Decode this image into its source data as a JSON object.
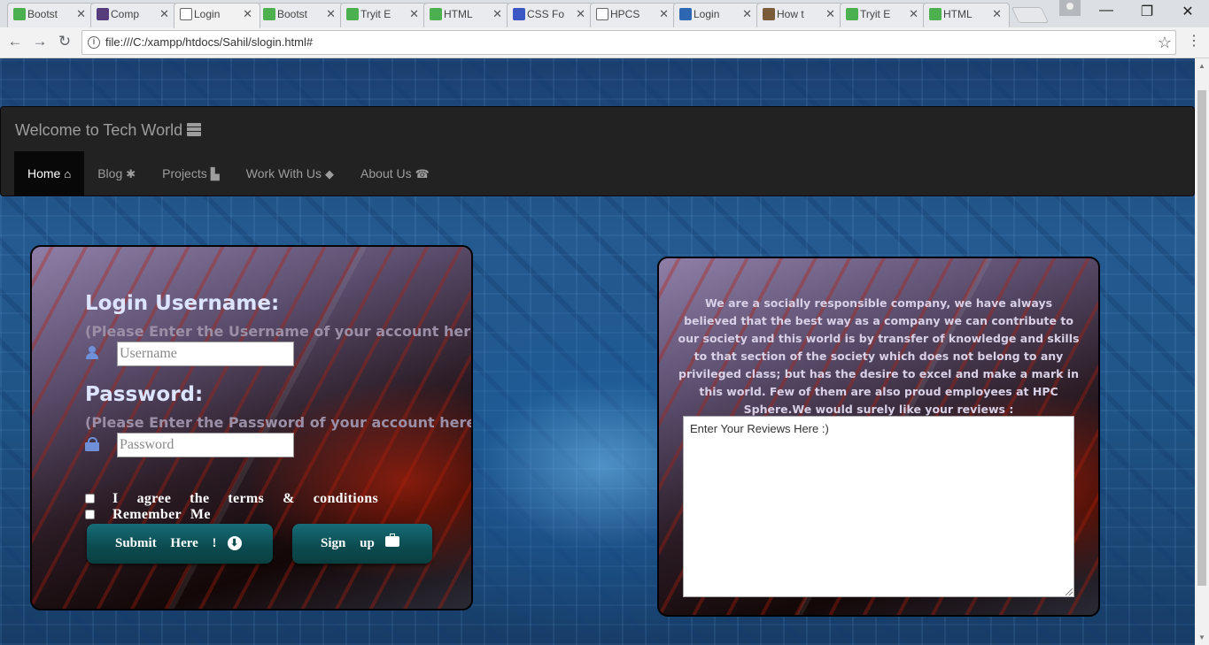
{
  "browser": {
    "tabs": [
      {
        "label": "Bootst",
        "icon": "w3schools-icon",
        "color": "#4caf50"
      },
      {
        "label": "Comp",
        "icon": "bootstrap-icon",
        "color": "#563d7c"
      },
      {
        "label": "Login",
        "icon": "page-icon",
        "color": "#ffffff",
        "active": true
      },
      {
        "label": "Bootst",
        "icon": "w3schools-icon",
        "color": "#4caf50"
      },
      {
        "label": "Tryit E",
        "icon": "w3schools-icon",
        "color": "#4caf50"
      },
      {
        "label": "HTML",
        "icon": "w3schools-icon",
        "color": "#4caf50"
      },
      {
        "label": "CSS Fo",
        "icon": "google-fonts-icon",
        "color": "#3b57c4"
      },
      {
        "label": "HPCS",
        "icon": "page-icon",
        "color": "#ffffff"
      },
      {
        "label": "Login",
        "icon": "h-logo-icon",
        "color": "#2f67b2"
      },
      {
        "label": "How t",
        "icon": "wikihow-icon",
        "color": "#7a5c3b"
      },
      {
        "label": "Tryit E",
        "icon": "w3schools-icon",
        "color": "#4caf50"
      },
      {
        "label": "HTML",
        "icon": "w3schools-icon",
        "color": "#4caf50"
      }
    ],
    "close_glyph": "✕",
    "url": "file:///C:/xampp/htdocs/Sahil/slogin.html#"
  },
  "navbar": {
    "brand": "Welcome to Tech World",
    "items": [
      {
        "label": "Home",
        "icon": "home-icon",
        "glyph": "⌂",
        "active": true
      },
      {
        "label": "Blog",
        "icon": "asterisk-icon",
        "glyph": "✱"
      },
      {
        "label": "Projects",
        "icon": "file-icon",
        "glyph": "▙"
      },
      {
        "label": "Work With Us",
        "icon": "tags-icon",
        "glyph": "◆"
      },
      {
        "label": "About Us",
        "icon": "phone-icon",
        "glyph": "☎"
      }
    ]
  },
  "login": {
    "username_heading": "Login Username:",
    "username_hint": "(Please Enter the Username of your account here)",
    "username_placeholder": "Username",
    "password_heading": "Password:",
    "password_hint": "(Please Enter the Password of your account here)",
    "password_placeholder": "Password",
    "agree_words": [
      "I",
      "agree",
      "the",
      "terms",
      "&",
      "conditions"
    ],
    "remember_label": "Remember   Me",
    "submit_label": "Submit Here !",
    "signup_label": "Sign up"
  },
  "review": {
    "text": "We are a socially responsible company, we have always believed that the best way as a company we can contribute to our society and this world is by transfer of knowledge and skills to that section of the society which does not belong to any privileged class; but has the desire to excel and make a mark in this world. Few of them are also proud employees at HPC Sphere.We would surely like your reviews :",
    "placeholder": "Enter Your Reviews Here :)"
  }
}
